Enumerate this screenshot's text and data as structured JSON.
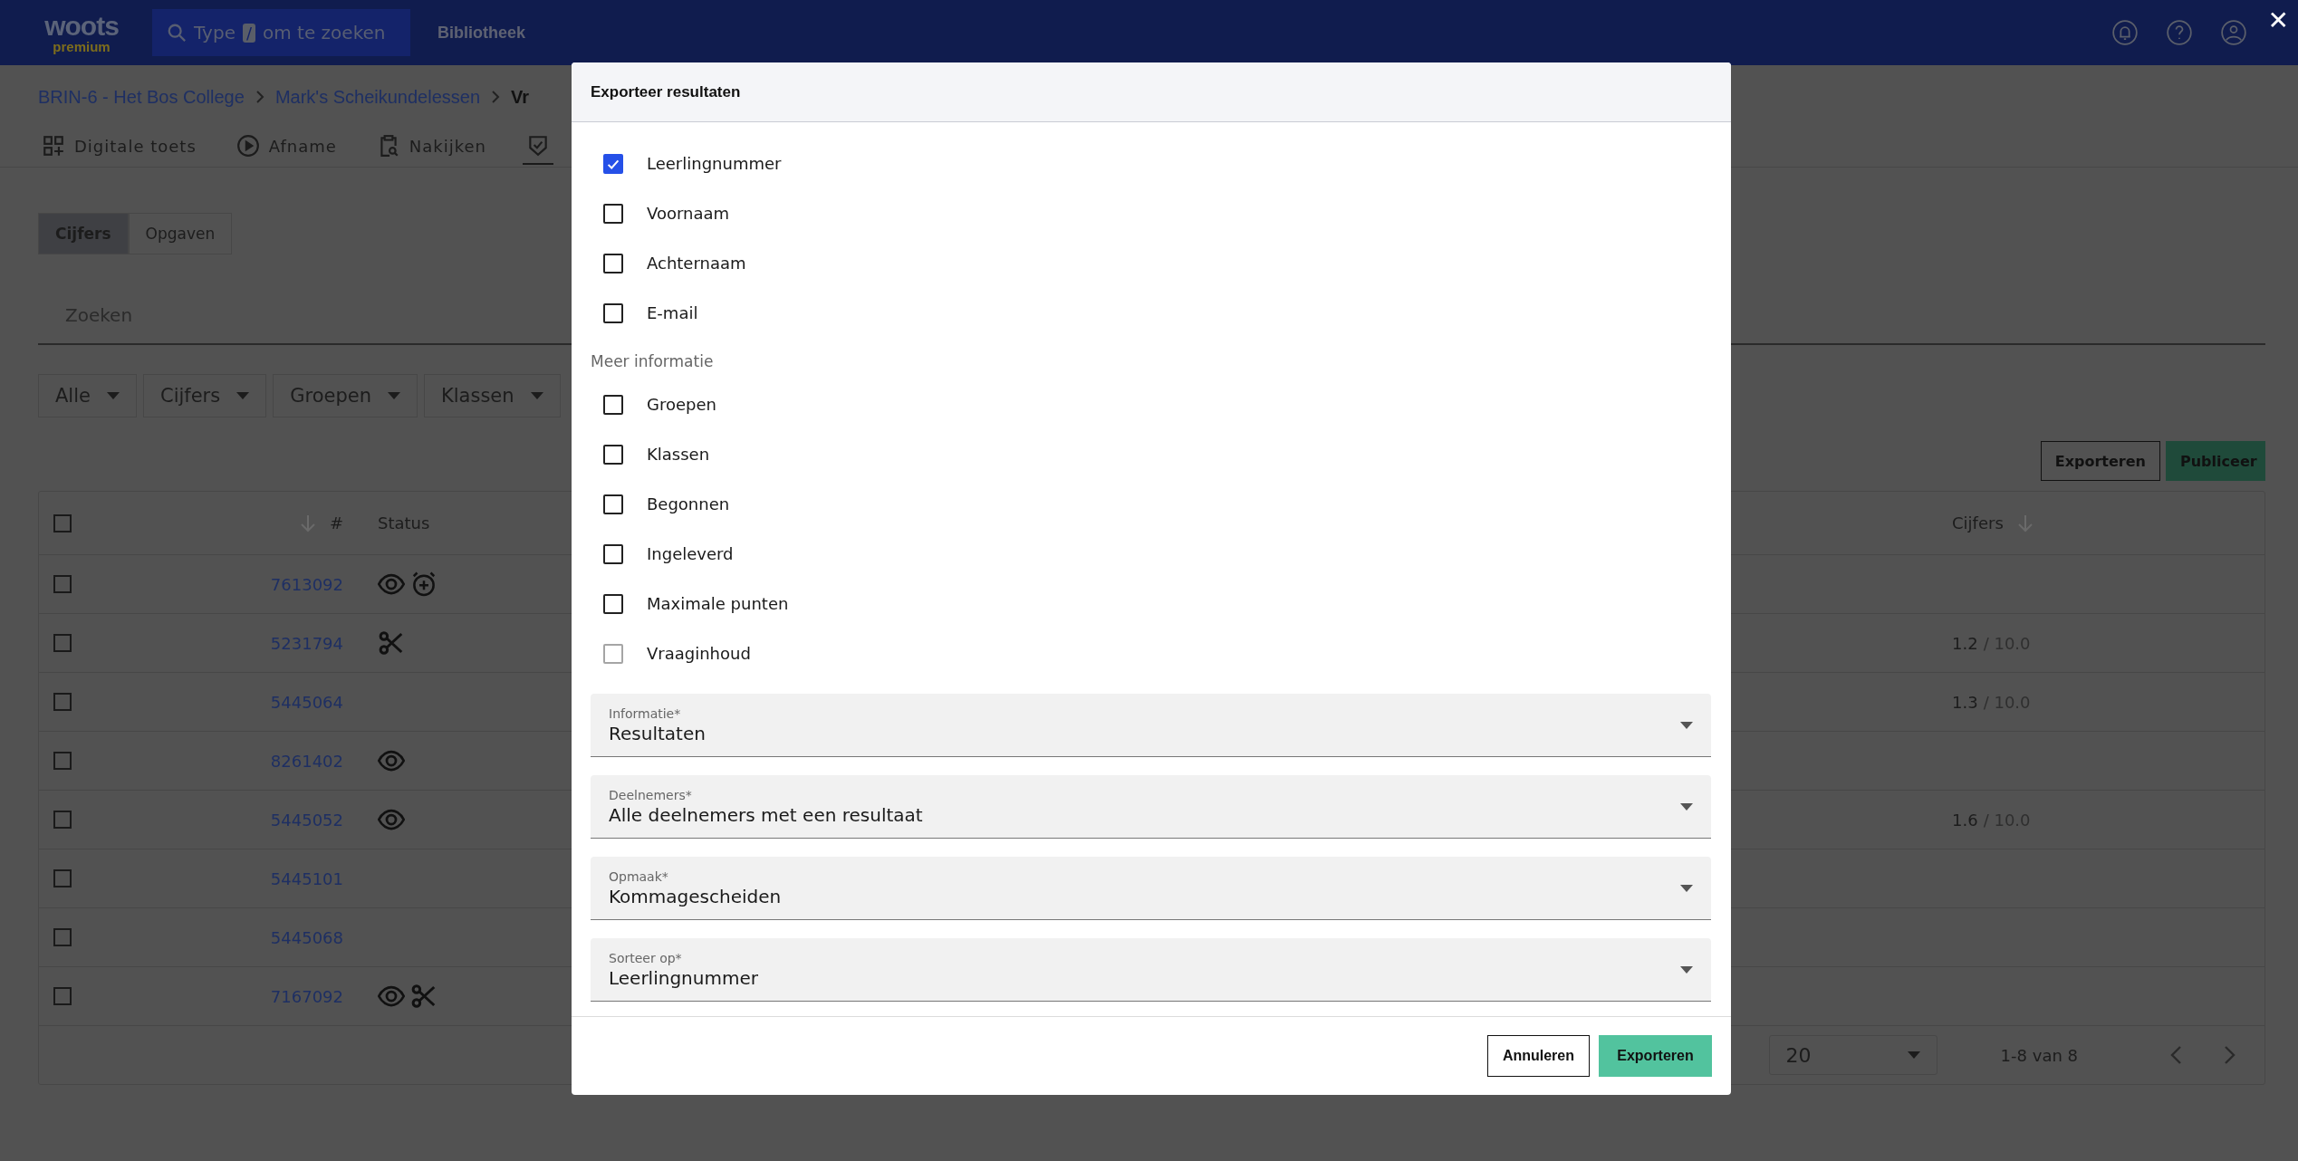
{
  "top_bar": {
    "logo": "woots",
    "logo_sub": "premium",
    "search": {
      "placeholder_start": "Type",
      "key": "/",
      "placeholder_end": "om te zoeken"
    },
    "nav_link": "Bibliotheek",
    "close": "✕"
  },
  "breadcrumb": [
    "BRIN-6 - Het Bos College",
    "Mark's Scheikundelessen",
    "Vr"
  ],
  "nav_tabs": [
    {
      "label": "Digitale toets",
      "selected": false
    },
    {
      "label": "Afname",
      "selected": false
    },
    {
      "label": "Nakijken",
      "selected": false
    },
    {
      "selected": true
    }
  ],
  "view_toggle": [
    {
      "label": "Cijfers",
      "selected": true
    },
    {
      "label": "Opgaven",
      "selected": false
    }
  ],
  "search": {
    "placeholder": "Zoeken"
  },
  "filters": [
    "Alle",
    "Cijfers",
    "Groepen",
    "Klassen"
  ],
  "actions": [
    {
      "label": "Exporteren",
      "kind": "outline"
    },
    {
      "label": "Publiceer",
      "kind": "primary"
    }
  ],
  "table": {
    "select_all_checked": false,
    "columns": [
      "#",
      "Status",
      "Cijfers"
    ],
    "rows": [
      {
        "checked": false,
        "number": "7613092",
        "status": [
          {
            "kind": "eye"
          },
          {
            "kind": "alarm"
          }
        ]
      },
      {
        "checked": false,
        "number": "5231794",
        "status": [
          {
            "kind": "scissors"
          }
        ],
        "grade": "1.2",
        "max": "/ 10.0"
      },
      {
        "checked": false,
        "number": "5445064",
        "grade": "1.3",
        "max": "/ 10.0"
      },
      {
        "checked": false,
        "number": "8261402",
        "status": [
          {
            "kind": "eye"
          }
        ]
      },
      {
        "checked": false,
        "number": "5445052",
        "status": [
          {
            "kind": "eye"
          }
        ],
        "grade": "1.6",
        "max": "/ 10.0"
      },
      {
        "checked": false,
        "number": "5445101"
      },
      {
        "checked": false,
        "number": "5445068"
      },
      {
        "checked": false,
        "number": "7167092",
        "status": [
          {
            "kind": "eye"
          },
          {
            "kind": "scissors"
          }
        ]
      }
    ],
    "page_size": "20",
    "range": "1-8 van 8"
  },
  "dialog": {
    "title": "Exporteer resultaten",
    "options": [
      {
        "label": "Leerlingnummer",
        "checked": true,
        "disabled": false
      },
      {
        "label": "Voornaam",
        "checked": false,
        "disabled": false
      },
      {
        "label": "Achternaam",
        "checked": false,
        "disabled": false
      },
      {
        "label": "E-mail",
        "checked": false,
        "disabled": false
      }
    ],
    "section": "Meer informatie",
    "more_options": [
      {
        "label": "Groepen",
        "checked": false,
        "disabled": false
      },
      {
        "label": "Klassen",
        "checked": false,
        "disabled": false
      },
      {
        "label": "Begonnen",
        "checked": false,
        "disabled": false
      },
      {
        "label": "Ingeleverd",
        "checked": false,
        "disabled": false
      },
      {
        "label": "Maximale punten",
        "checked": false,
        "disabled": false
      },
      {
        "label": "Vraaginhoud",
        "checked": false,
        "disabled": true
      }
    ],
    "selects": [
      {
        "label": "Informatie*",
        "value": "Resultaten"
      },
      {
        "label": "Deelnemers*",
        "value": "Alle deelnemers met een resultaat"
      },
      {
        "label": "Opmaak*",
        "value": "Kommagescheiden"
      },
      {
        "label": "Sorteer op*",
        "value": "Leerlingnummer"
      }
    ],
    "buttons": [
      {
        "label": "Annuleren",
        "kind": "secondary"
      },
      {
        "label": "Exporteren",
        "kind": "primary"
      }
    ]
  }
}
